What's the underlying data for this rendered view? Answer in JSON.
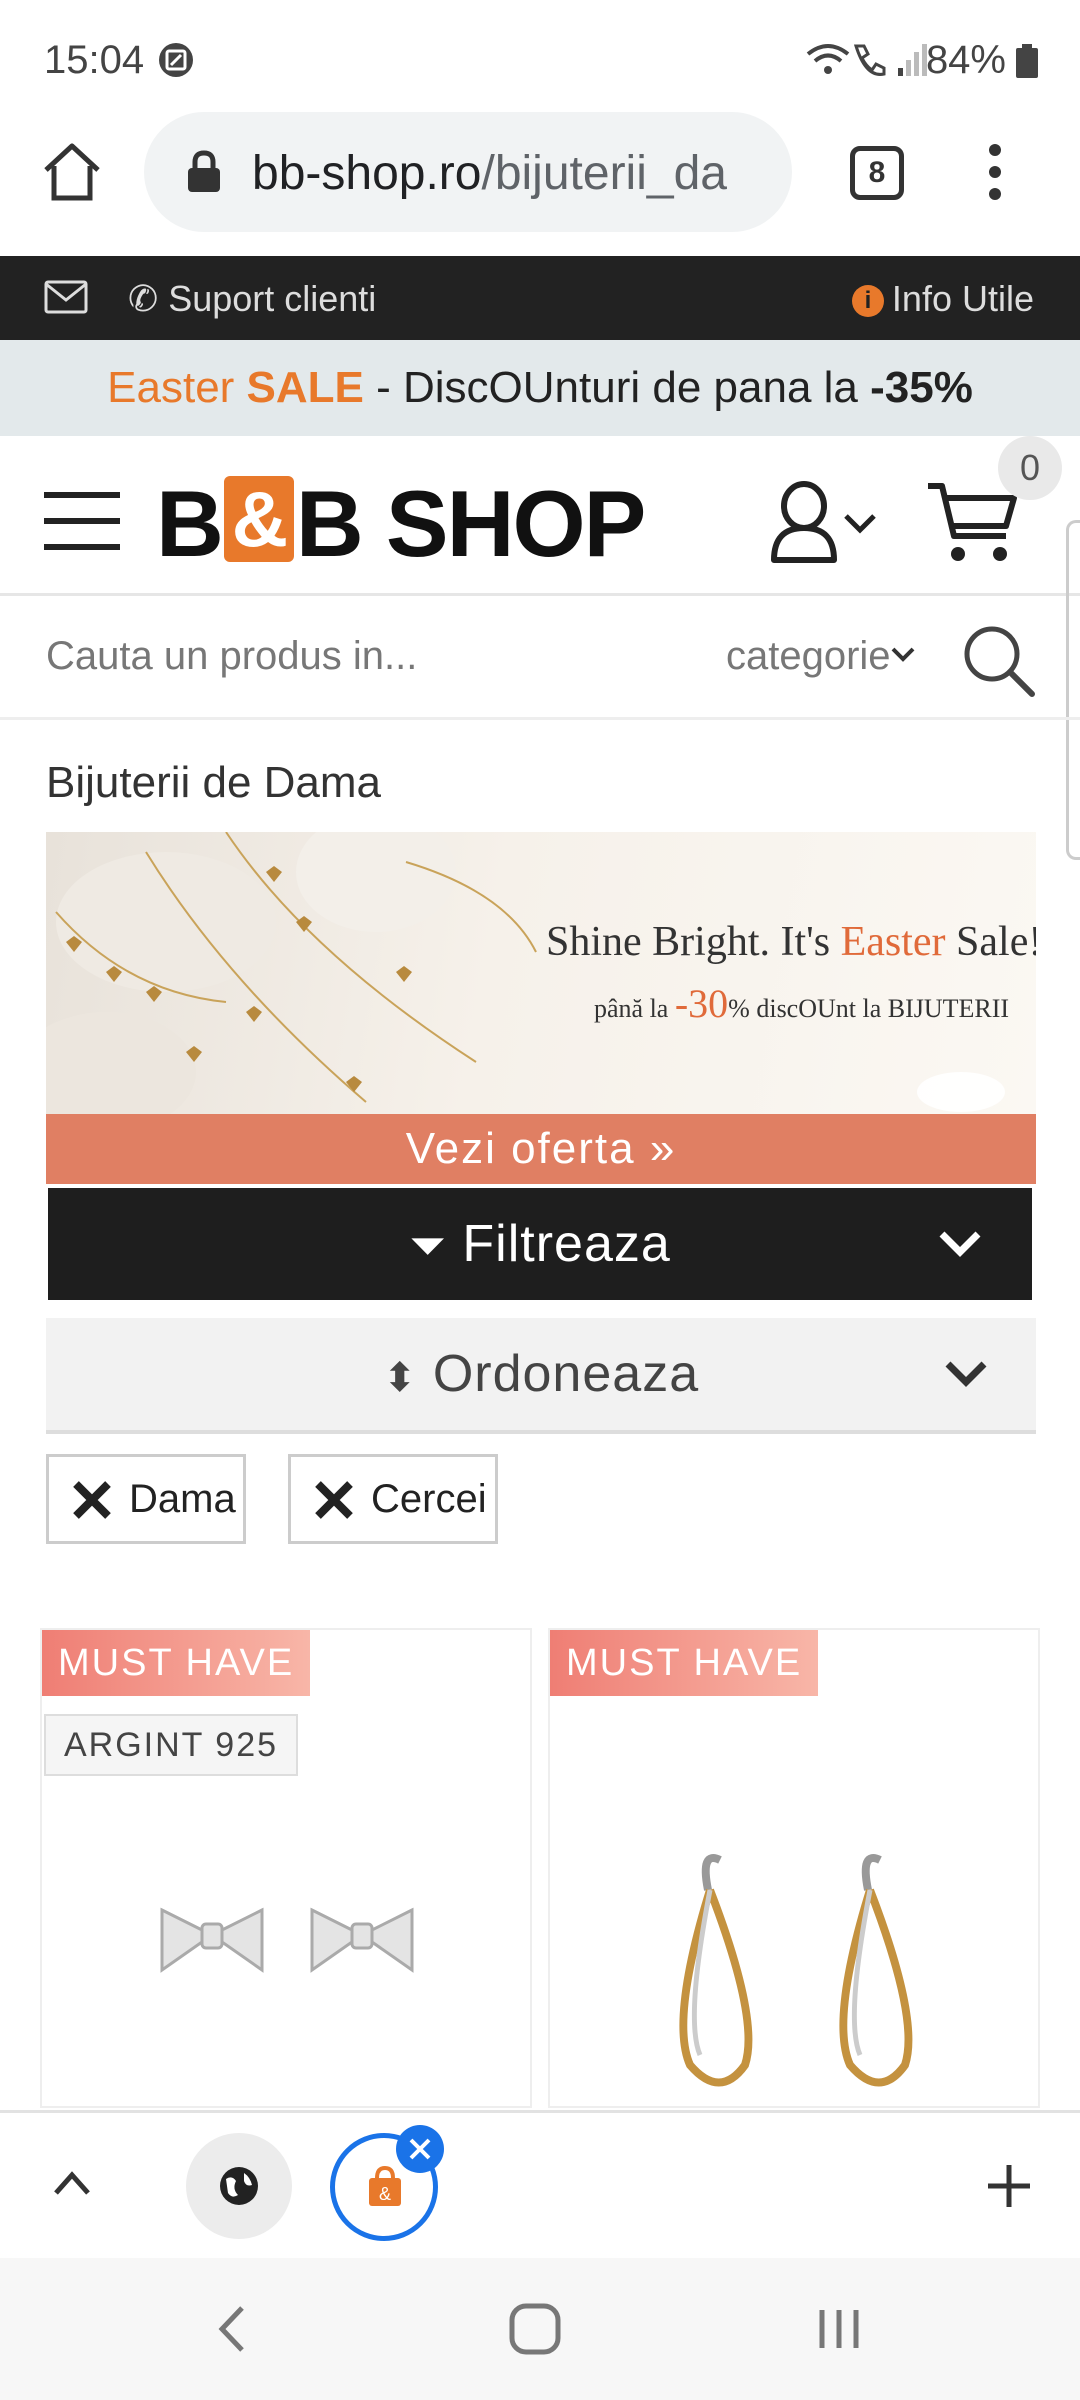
{
  "status": {
    "time": "15:04",
    "battery": "84%"
  },
  "browser": {
    "url_domain": "bb-shop.ro",
    "url_path": "/bijuterii_da",
    "tab_count": "8"
  },
  "topbar": {
    "support_label": "Suport clienti",
    "info_label": "Info Utile"
  },
  "sale_banner": {
    "part1": "Easter ",
    "part2": "SALE",
    "part3": " - DiscOUnturi de pana la ",
    "part4": "-35%"
  },
  "header": {
    "logo_left": "B",
    "logo_amp": "&",
    "logo_right": "B SHOP",
    "cart_count": "0"
  },
  "search": {
    "placeholder": "Cauta un produs in...",
    "category_label": "categorie"
  },
  "page": {
    "title": "Bijuterii de Dama"
  },
  "promo": {
    "tagline_a": "Shine Bright. It's ",
    "tagline_b": "Easter",
    "tagline_c": " Sale!",
    "sub_a": "până la ",
    "sub_b": "-30",
    "sub_c": "%",
    "sub_d": " discOUnt la BIJUTERII",
    "button_label": "Vezi oferta »"
  },
  "filters": {
    "filter_label": "Filtreaza",
    "sort_label": "Ordoneaza",
    "chips": [
      "Dama",
      "Cercei"
    ]
  },
  "products": [
    {
      "badge": "MUST HAVE",
      "material": "ARGINT 925"
    },
    {
      "badge": "MUST HAVE"
    }
  ],
  "colors": {
    "accent": "#e8792b",
    "dark": "#1e1e1e",
    "offer": "#e07f63",
    "chrome_blue": "#1a73e8"
  }
}
